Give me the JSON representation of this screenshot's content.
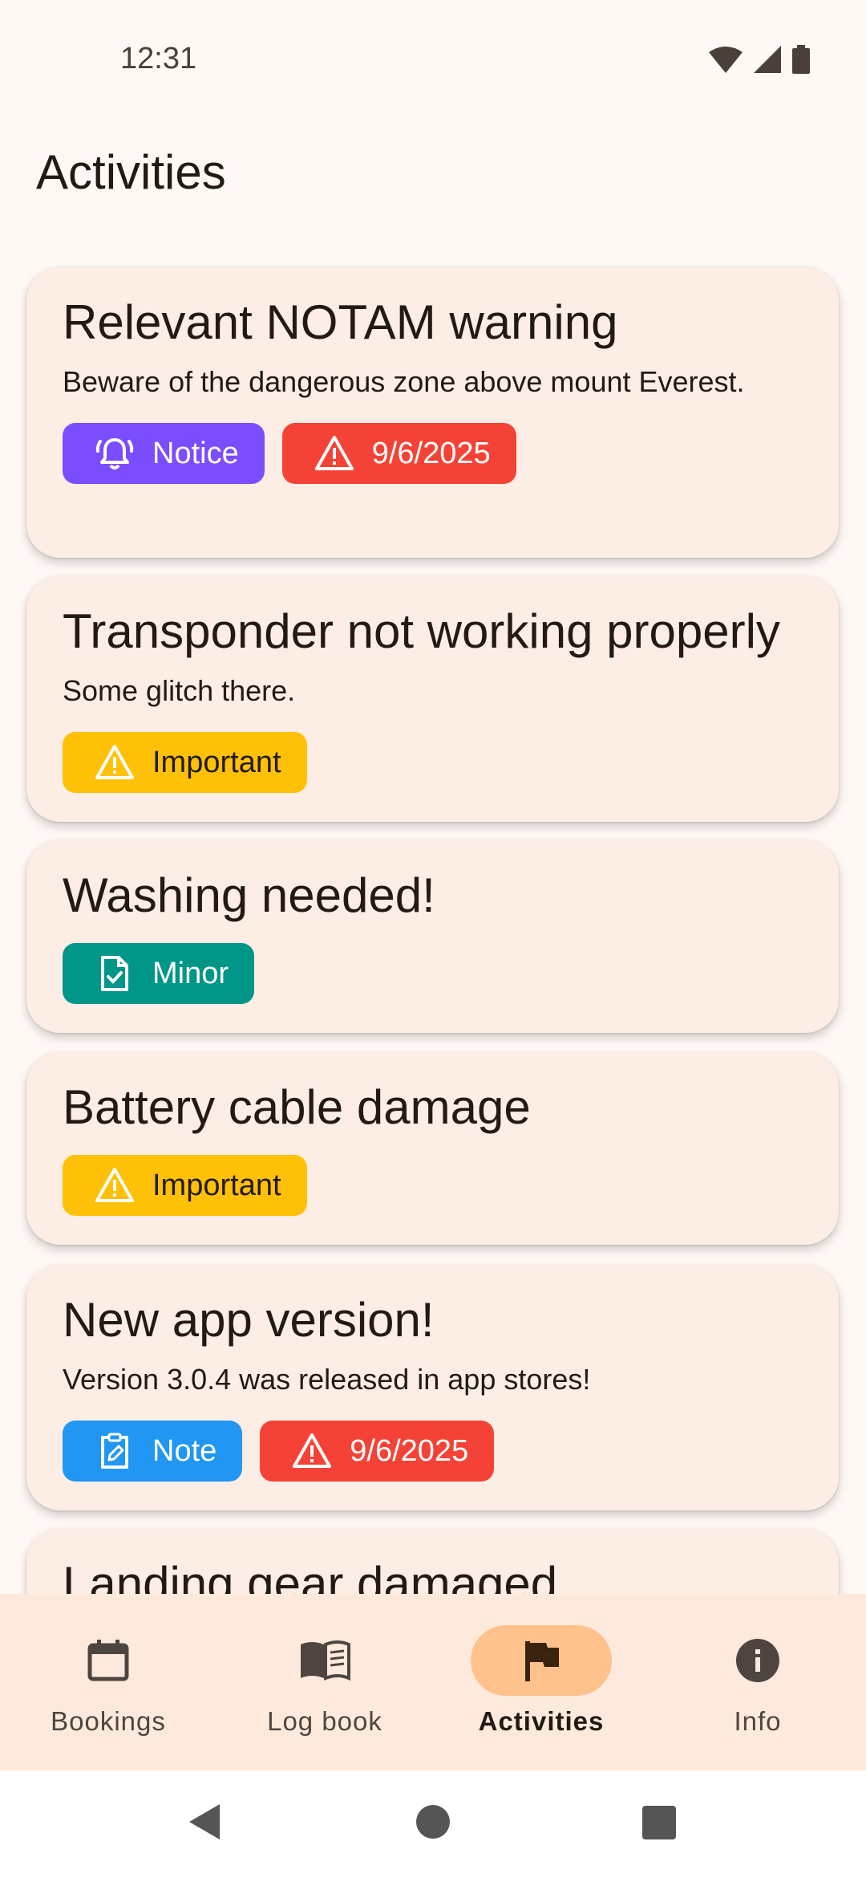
{
  "status_bar": {
    "time": "12:31"
  },
  "page": {
    "title": "Activities"
  },
  "activities": [
    {
      "title": "Relevant NOTAM warning",
      "description": "Beware of the dangerous zone above mount Everest.",
      "chips": [
        {
          "label": "Notice",
          "icon": "bell-alert-icon"
        },
        {
          "label": "9/6/2025",
          "icon": "warning-icon"
        }
      ]
    },
    {
      "title": "Transponder not working properly",
      "description": "Some glitch there.",
      "chips": [
        {
          "label": "Important",
          "icon": "warning-icon"
        }
      ]
    },
    {
      "title": "Washing needed!",
      "chips": [
        {
          "label": "Minor",
          "icon": "document-check-icon"
        }
      ]
    },
    {
      "title": "Battery cable damage",
      "chips": [
        {
          "label": "Important",
          "icon": "warning-icon"
        }
      ]
    },
    {
      "title": "New app version!",
      "description": "Version 3.0.4 was released in app stores!",
      "chips": [
        {
          "label": "Note",
          "icon": "clipboard-edit-icon"
        },
        {
          "label": "9/6/2025",
          "icon": "warning-icon"
        }
      ]
    },
    {
      "title": "Landing gear damaged"
    }
  ],
  "bottom_nav": {
    "items": [
      {
        "label": "Bookings",
        "icon": "calendar-icon"
      },
      {
        "label": "Log book",
        "icon": "book-icon"
      },
      {
        "label": "Activities",
        "icon": "flag-icon",
        "active": true
      },
      {
        "label": "Info",
        "icon": "info-icon"
      }
    ]
  },
  "colors": {
    "notice": "#7C4DFF",
    "date": "#F44336",
    "important": "#FFC107",
    "minor": "#009688",
    "note": "#2196F3",
    "active_nav": "#FFC28C",
    "background": "#FFF8F5",
    "card": "#FDEEE5"
  }
}
